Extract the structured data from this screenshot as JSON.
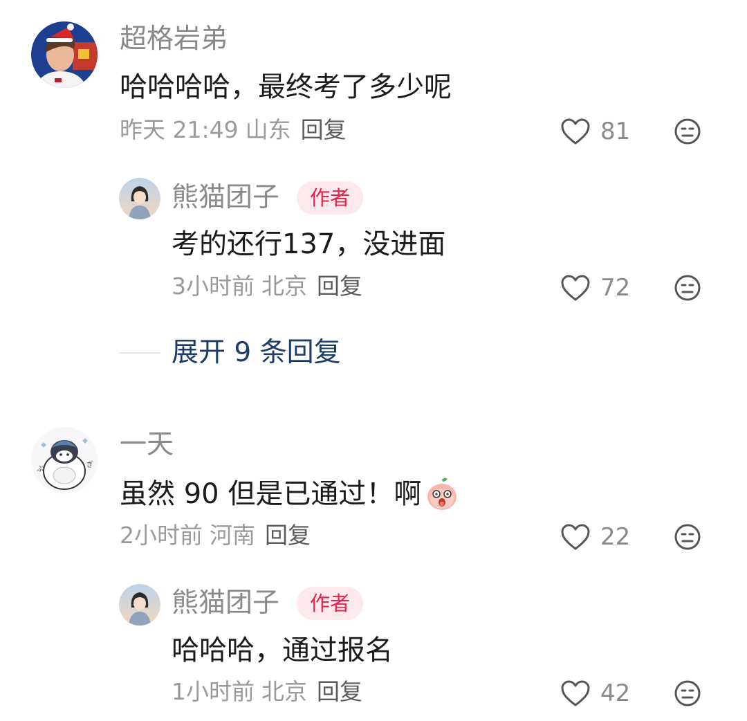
{
  "comments": [
    {
      "username": "超格岩弟",
      "content": "哈哈哈哈，最终考了多少呢",
      "time": "昨天 21:49",
      "location": "山东",
      "reply_label": "回复",
      "likes": "81",
      "replies": [
        {
          "username": "熊猫团子",
          "badge": "作者",
          "content": "考的还行137，没进面",
          "time": "3小时前",
          "location": "北京",
          "reply_label": "回复",
          "likes": "72"
        }
      ],
      "expand_label": "展开 9 条回复"
    },
    {
      "username": "一天",
      "content": "虽然 90 但是已通过！啊",
      "time": "2小时前",
      "location": "河南",
      "reply_label": "回复",
      "likes": "22",
      "replies": [
        {
          "username": "熊猫团子",
          "badge": "作者",
          "content": "哈哈哈，通过报名",
          "time": "1小时前",
          "location": "北京",
          "reply_label": "回复",
          "likes": "42"
        }
      ]
    }
  ],
  "icons": {
    "like": "heart-outline-icon",
    "dislike": "neutral-face-icon",
    "emoji": "surprised-peach-emoji"
  }
}
